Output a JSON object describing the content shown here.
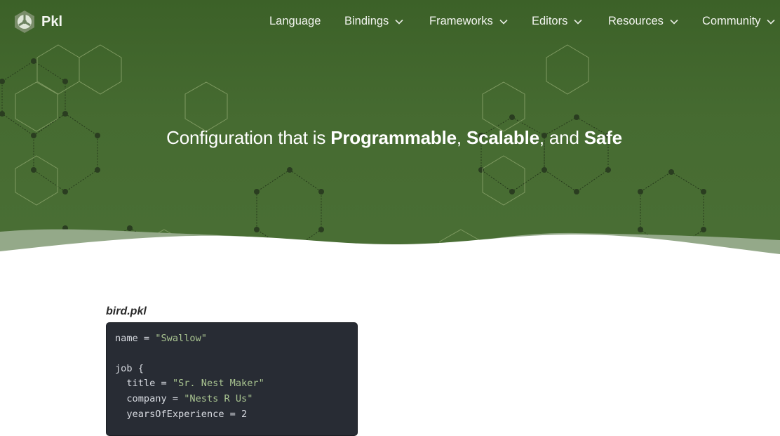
{
  "brand": {
    "name": "Pkl",
    "logo_icon": "pkl-logo-icon"
  },
  "nav": {
    "items": [
      {
        "label": "Language",
        "dropdown": false
      },
      {
        "label": "Bindings",
        "dropdown": true
      },
      {
        "label": "Frameworks",
        "dropdown": true
      },
      {
        "label": "Editors",
        "dropdown": true
      },
      {
        "label": "Resources",
        "dropdown": true
      },
      {
        "label": "Community",
        "dropdown": true
      }
    ]
  },
  "hero": {
    "headline": {
      "prefix": "Configuration that is ",
      "word1": "Programmable",
      "sep1": ", ",
      "word2": "Scalable",
      "sep2": ", and ",
      "word3": "Safe"
    }
  },
  "example": {
    "filename": "bird.pkl",
    "code": {
      "l1_pre": "name = ",
      "l1_str": "\"Swallow\"",
      "l3": "job {",
      "l4_pre": "  title = ",
      "l4_str": "\"Sr. Nest Maker\"",
      "l5_pre": "  company = ",
      "l5_str": "\"Nests R Us\"",
      "l6": "  yearsOfExperience = 2"
    }
  },
  "colors": {
    "hero_green": "#466b31",
    "wave_light": "#94a989",
    "code_bg": "#282c34",
    "string_green": "#a9c491"
  }
}
